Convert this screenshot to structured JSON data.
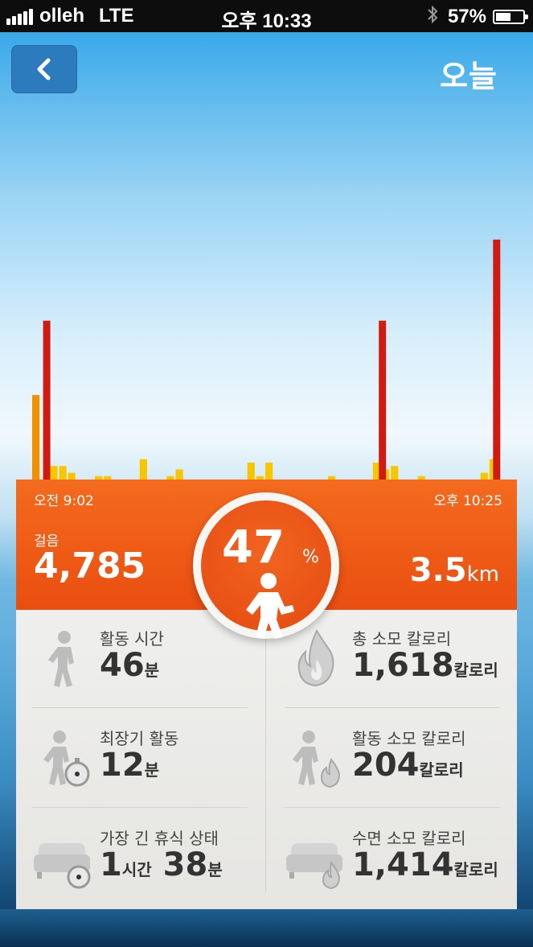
{
  "status_bar": {
    "carrier": "olleh",
    "network": "LTE",
    "time": "오후 10:33",
    "battery": "57%",
    "battery_level": 0.57,
    "signal_bars": 5
  },
  "header": {
    "title": "오늘",
    "back_icon": "chevron-left-icon"
  },
  "chart_data": {
    "type": "bar",
    "start_label": "오전 9:02",
    "end_label": "오후 10:25",
    "series": [
      {
        "color": "#f5a300",
        "values": [
          0.25,
          0,
          0.04,
          0.04,
          0.02,
          0,
          0,
          0.01,
          0.01,
          0,
          0,
          0,
          0.06,
          0,
          0,
          0.01,
          0.03,
          0,
          0,
          0,
          0,
          0,
          0,
          0,
          0.05,
          0.01,
          0.05,
          0,
          0,
          0,
          0,
          0,
          0,
          0.01,
          0,
          0,
          0,
          0,
          0.05,
          0.03,
          0.04,
          0,
          0,
          0.01,
          0,
          0,
          0,
          0,
          0,
          0,
          0.02,
          0.06
        ]
      },
      {
        "color": "#cf1b12",
        "values": [
          0.47,
          0.47,
          0.47,
          0.71
        ]
      }
    ],
    "colors": {
      "active": "#f7c600",
      "active_dark": "#f29100",
      "peak": "#cf1b12"
    }
  },
  "summary": {
    "time_start": "오전 9:02",
    "time_end": "오후 10:25",
    "steps_label": "걸음",
    "steps_value": "4,785",
    "distance_value": "3.5",
    "distance_unit": "km",
    "percent": "47",
    "percent_sign": "%"
  },
  "stats": {
    "active_time": {
      "label": "활동 시간",
      "value": "46",
      "unit": "분",
      "icon": "walking-person-icon"
    },
    "longest_active": {
      "label": "최장기 활동",
      "value": "12",
      "unit": "분",
      "icon": "person-stopwatch-icon"
    },
    "longest_idle": {
      "label": "가장 긴 휴식 상태",
      "hours": "1",
      "hours_unit": "시간",
      "minutes": "38",
      "minutes_unit": "분",
      "icon": "armchair-stopwatch-icon"
    },
    "total_calories": {
      "label": "총 소모 칼로리",
      "value": "1,618",
      "unit": "칼로리",
      "icon": "flame-icon"
    },
    "active_calories": {
      "label": "활동 소모 칼로리",
      "value": "204",
      "unit": "칼로리",
      "icon": "person-flame-icon"
    },
    "sleep_calories": {
      "label": "수면 소모 칼로리",
      "value": "1,414",
      "unit": "칼로리",
      "icon": "armchair-flame-icon"
    }
  }
}
